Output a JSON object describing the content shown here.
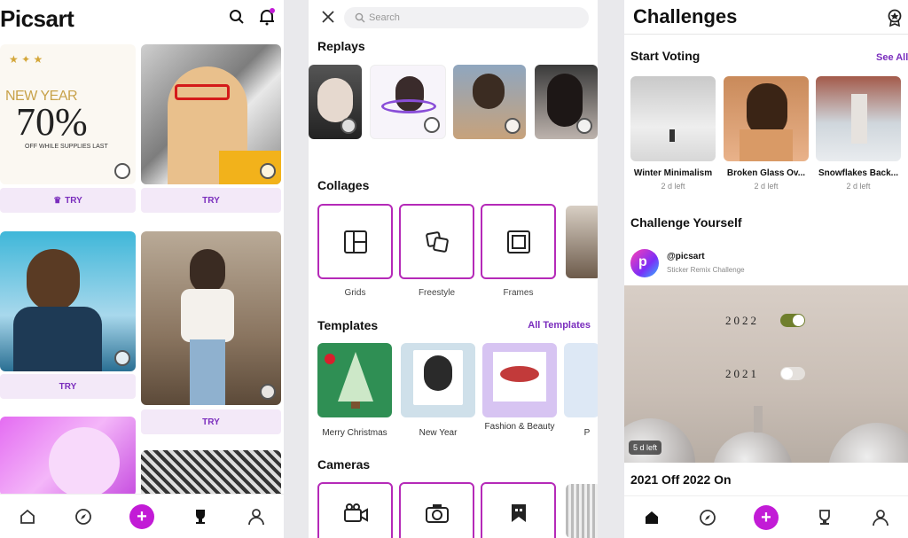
{
  "feed": {
    "logo": "Picsart",
    "promo": {
      "line1": "NEW YEAR",
      "discount": "70%",
      "line3": "OFF WHILE SUPPLIES LAST"
    },
    "try_label": "TRY",
    "nav_icons": [
      "home-icon",
      "compass-icon",
      "plus-icon",
      "trophy-icon",
      "profile-icon"
    ]
  },
  "explore": {
    "search_placeholder": "Search",
    "replays_title": "Replays",
    "collages_title": "Collages",
    "collages": [
      "Grids",
      "Freestyle",
      "Frames"
    ],
    "templates_title": "Templates",
    "templates_link": "All Templates",
    "templates": [
      "Merry Christmas",
      "New Year",
      "Fashion & Beauty",
      "P"
    ],
    "cameras_title": "Cameras"
  },
  "challenges": {
    "title": "Challenges",
    "start_voting": "Start Voting",
    "see_all": "See All",
    "items": [
      {
        "name": "Winter Minimalism",
        "left": "2 d left"
      },
      {
        "name": "Broken Glass Ov...",
        "left": "2 d left"
      },
      {
        "name": "Snowflakes Back...",
        "left": "2 d left"
      }
    ],
    "challenge_yourself": "Challenge Yourself",
    "user": "@picsart",
    "user_sub": "Sticker Remix Challenge",
    "year_a": "2022",
    "year_b": "2021",
    "days_left": "5 d left",
    "card_title": "2021 Off 2022 On"
  },
  "colors": {
    "accent": "#c21bd6",
    "purple": "#7a2dbd"
  }
}
